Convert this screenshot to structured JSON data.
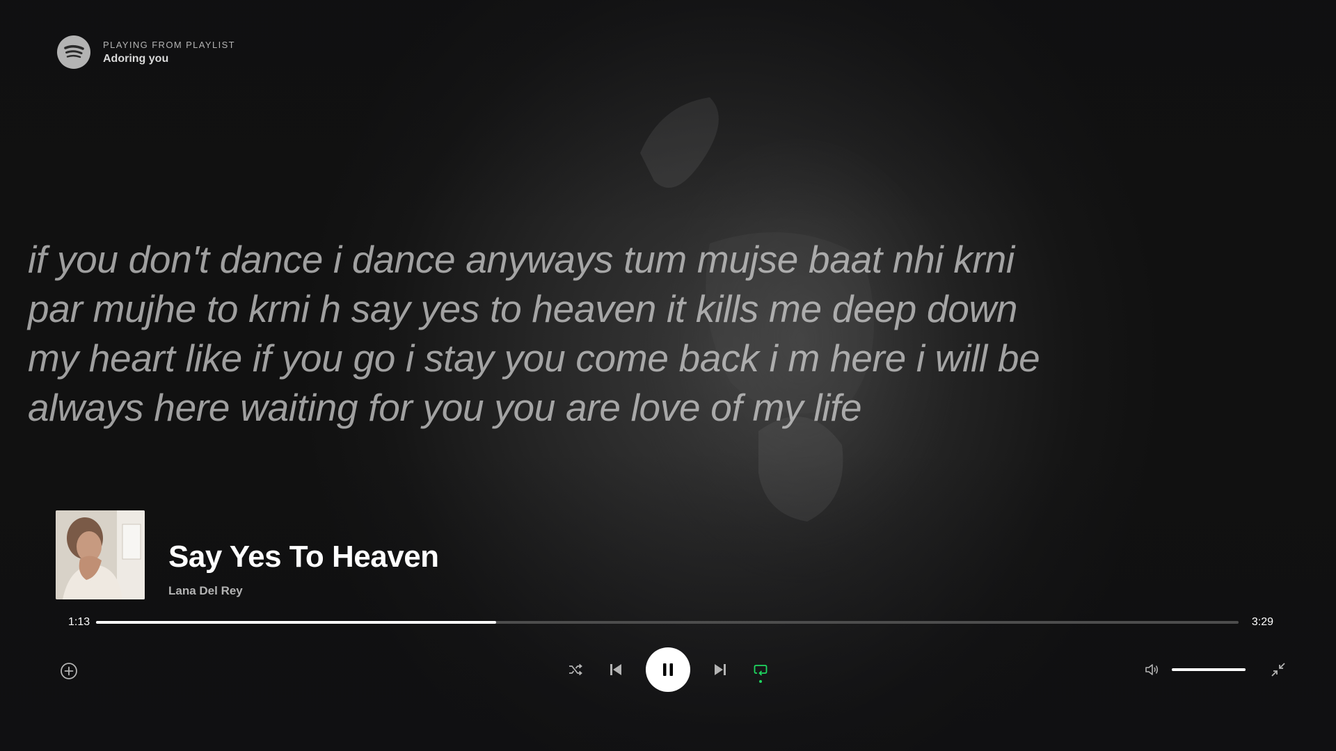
{
  "context": {
    "label": "PLAYING FROM PLAYLIST",
    "playlist": "Adoring you"
  },
  "lyrics": {
    "lines": [
      "if you don't dance i dance anyways tum mujse baat nhi krni",
      "par mujhe to krni h say yes to heaven it kills me deep down",
      "my heart like if you go i stay you come back i m here i will be",
      "always here waiting for you you are love of my life"
    ]
  },
  "track": {
    "title": "Say Yes To Heaven",
    "artist": "Lana Del Rey"
  },
  "playback": {
    "elapsed": "1:13",
    "duration": "3:29",
    "progress_fraction": 0.35,
    "state": "playing",
    "repeat_active": true,
    "volume_fraction": 1.0
  },
  "icons": {
    "logo": "spotify-logo-icon",
    "add": "plus-circle-icon",
    "shuffle": "shuffle-icon",
    "previous": "skip-back-icon",
    "pause": "pause-icon",
    "next": "skip-forward-icon",
    "repeat": "repeat-icon",
    "volume": "volume-icon",
    "fullscreen_exit": "minimize-icon"
  },
  "colors": {
    "accent": "#1ed760",
    "background": "#121212",
    "text_secondary": "#b3b3b3"
  }
}
